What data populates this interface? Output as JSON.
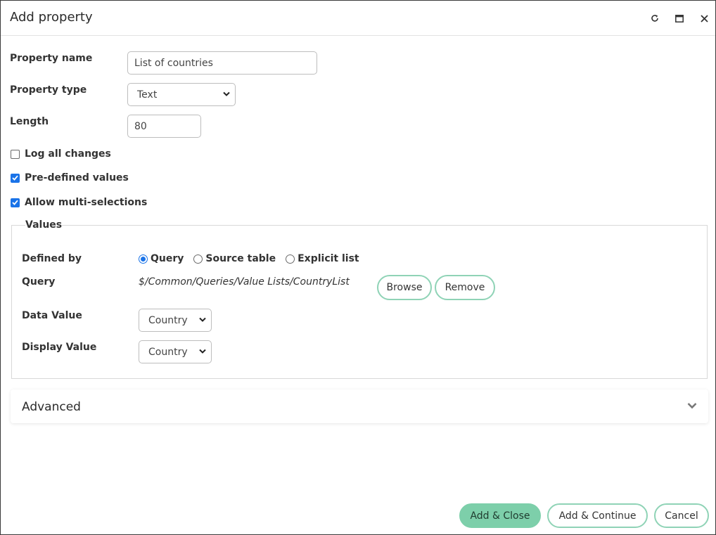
{
  "dialog": {
    "title": "Add property",
    "icons": [
      "refresh-icon",
      "maximize-icon",
      "close-icon"
    ]
  },
  "form": {
    "property_name_label": "Property name",
    "property_name_value": "List of countries",
    "property_type_label": "Property type",
    "property_type_value": "Text",
    "length_label": "Length",
    "length_value": "80",
    "log_all_changes_label": "Log all changes",
    "log_all_changes_checked": false,
    "predefined_values_label": "Pre-defined values",
    "predefined_values_checked": true,
    "allow_multi_label": "Allow multi-selections",
    "allow_multi_checked": true
  },
  "values": {
    "legend": "Values",
    "defined_by_label": "Defined by",
    "options": [
      {
        "label": "Query",
        "selected": true
      },
      {
        "label": "Source table",
        "selected": false
      },
      {
        "label": "Explicit list",
        "selected": false
      }
    ],
    "query_label": "Query",
    "query_path": "$/Common/Queries/Value Lists/CountryList",
    "browse_label": "Browse",
    "remove_label": "Remove",
    "data_value_label": "Data Value",
    "data_value_selected": "Country",
    "display_value_label": "Display Value",
    "display_value_selected": "Country"
  },
  "advanced": {
    "label": "Advanced",
    "expanded": false
  },
  "footer": {
    "add_close_label": "Add & Close",
    "add_continue_label": "Add & Continue",
    "cancel_label": "Cancel"
  },
  "colors": {
    "accent_green": "#7dcfaa",
    "pill_border": "#8fd3b6",
    "checkbox_blue": "#1a73e8"
  }
}
